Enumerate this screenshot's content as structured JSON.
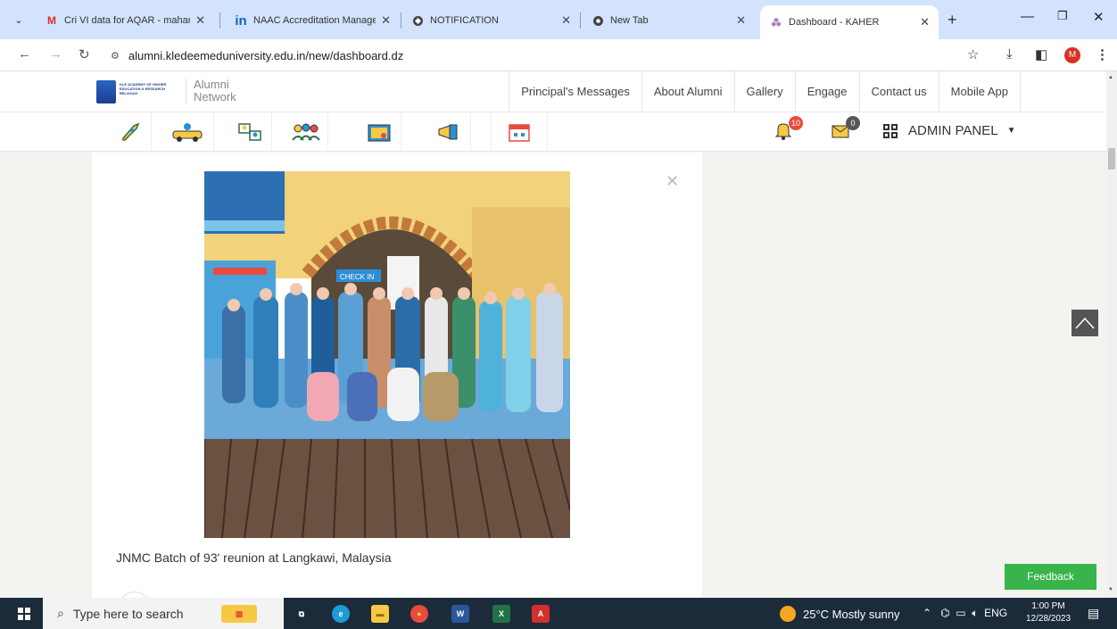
{
  "browser": {
    "tabs": [
      {
        "title": "Cri VI data for AQAR - mahar",
        "icon": "gmail-icon"
      },
      {
        "title": "NAAC Accreditation Manage",
        "icon": "linkedin-icon"
      },
      {
        "title": "NOTIFICATION",
        "icon": "globe-icon"
      },
      {
        "title": "New Tab",
        "icon": "chrome-icon"
      },
      {
        "title": "Dashboard - KAHER",
        "icon": "site-icon",
        "active": true
      }
    ],
    "url": "alumni.kledeemeduniversity.edu.in/new/dashboard.dz",
    "profile_initial": "M"
  },
  "site": {
    "logo_text": "KLE ACADEMY OF HIGHER EDUCATION & RESEARCH BELAGAVI",
    "brand": [
      "Alumni",
      "Network"
    ],
    "nav": [
      "Principal's Messages",
      "About Alumni",
      "Gallery",
      "Engage",
      "Contact us",
      "Mobile App"
    ],
    "icon_bar": [
      "rocket-icon",
      "car-icon",
      "people-cards-icon",
      "group-icon",
      "folder-icon",
      "megaphone-icon",
      "calendar-icon"
    ],
    "notifications_count": "10",
    "messages_count": "0",
    "admin_label": "ADMIN PANEL"
  },
  "post": {
    "caption": "JNMC Batch of 93' reunion at Langkawi, Malaysia",
    "photo_sign": "CHECK IN"
  },
  "feedback_label": "Feedback",
  "taskbar": {
    "search_placeholder": "Type here to search",
    "weather": "25°C  Mostly sunny",
    "lang": "ENG",
    "time": "1:00 PM",
    "date": "12/28/2023"
  },
  "colors": {
    "tabstrip": "#d3e3fd",
    "feedback": "#38b44a",
    "badge_notif": "#e94b3c",
    "badge_mail": "#555555"
  }
}
